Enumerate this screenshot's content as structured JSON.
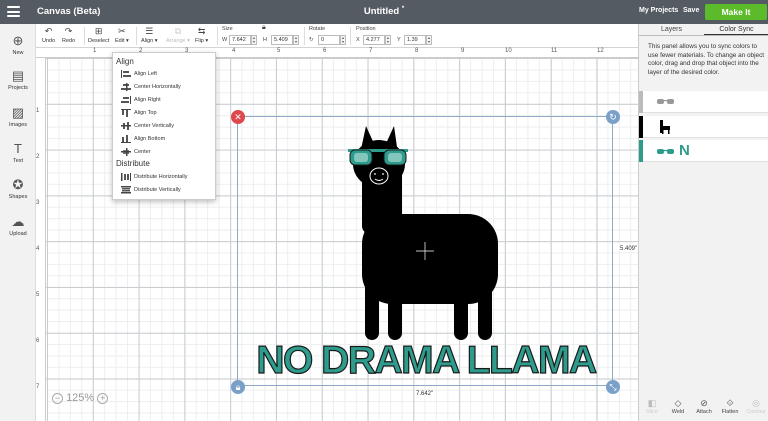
{
  "topbar": {
    "app_title": "Canvas (Beta)",
    "doc_title": "Untitled",
    "doc_modified_mark": "*",
    "my_projects": "My Projects",
    "save": "Save",
    "make_it": "Make It"
  },
  "toolbar": {
    "undo": "Undo",
    "redo": "Redo",
    "deselect": "Deselect",
    "edit": "Edit",
    "align": "Align",
    "arrange": "Arrange",
    "flip": "Flip",
    "size_label": "Size",
    "w_label": "W",
    "w_value": "7.642",
    "h_label": "H",
    "h_value": "5.409",
    "rotate_label": "Rotate",
    "rotate_value": "0",
    "position_label": "Position",
    "x_label": "X",
    "x_value": "4.277",
    "y_label": "Y",
    "y_value": "1.39"
  },
  "leftbar": {
    "new": "New",
    "projects": "Projects",
    "images": "Images",
    "text": "Text",
    "shapes": "Shapes",
    "upload": "Upload"
  },
  "ruler": {
    "top": [
      "1",
      "2",
      "3",
      "4",
      "5",
      "6",
      "7",
      "8",
      "9",
      "10",
      "11",
      "12"
    ],
    "left": [
      "1",
      "2",
      "3",
      "4",
      "5",
      "6",
      "7"
    ]
  },
  "align_menu": {
    "align_heading": "Align",
    "items": [
      "Align Left",
      "Center Horizontally",
      "Align Right",
      "Align Top",
      "Center Vertically",
      "Align Bottom",
      "Center"
    ],
    "distribute_heading": "Distribute",
    "distribute_items": [
      "Distribute Horizontally",
      "Distribute Vertically"
    ]
  },
  "design": {
    "text": "NO DRAMA LLAMA",
    "text_color": "#2e9c8c",
    "llama_color": "#000000",
    "glasses_color": "#2e9c8c"
  },
  "selection": {
    "width_label": "7.642\"",
    "height_label": "5.409\""
  },
  "zoom": {
    "value": "125%"
  },
  "panel": {
    "tab_layers": "Layers",
    "tab_color_sync": "Color Sync",
    "description": "This panel allows you to sync colors to use fewer materials. To change an object color, drag and drop that object into the layer of the desired color.",
    "layer3_letter": "N"
  },
  "bottom_tools": [
    "Slice",
    "Weld",
    "Attach",
    "Flatten",
    "Contour"
  ],
  "colors": {
    "topbar": "#545b62",
    "make_it": "#5cbb2a",
    "teal": "#2e9c8c",
    "delete_handle": "#e0474c",
    "blue_handle": "#7aa0c9"
  }
}
